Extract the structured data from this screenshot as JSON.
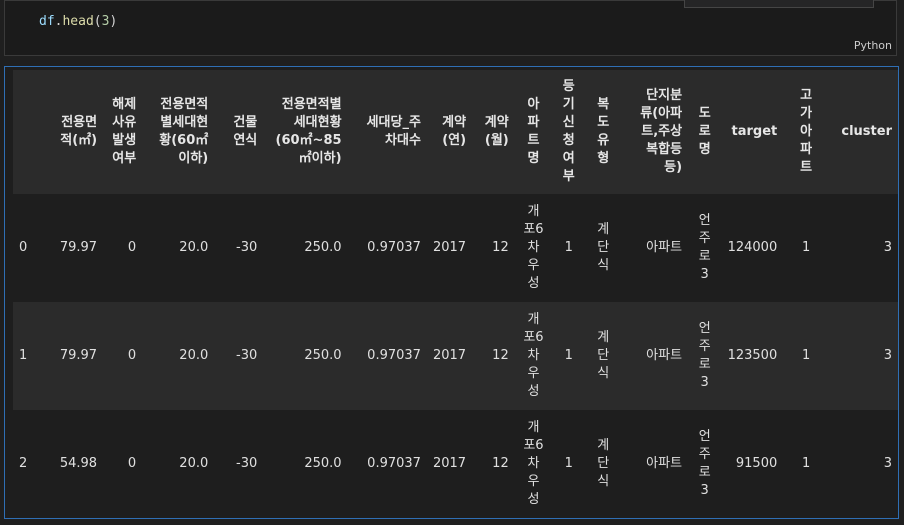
{
  "code_cell": {
    "code_object": "df",
    "code_method": "head",
    "code_arg": "3",
    "language": "Python"
  },
  "table": {
    "columns": [
      {
        "label": "",
        "type": "idx"
      },
      {
        "label": "전용면\n적(㎡)",
        "type": "num"
      },
      {
        "label": "해제\n사유\n발생\n여부",
        "type": "num"
      },
      {
        "label": "전용면적\n별세대현\n황(60㎡\n이하)",
        "type": "num"
      },
      {
        "label": "건물\n연식",
        "type": "num"
      },
      {
        "label": "전용면적별\n세대현황\n(60㎡~85\n㎡이하)",
        "type": "num"
      },
      {
        "label": "세대당_주\n차대수",
        "type": "num"
      },
      {
        "label": "계약\n(연)",
        "type": "num"
      },
      {
        "label": "계약\n(월)",
        "type": "num"
      },
      {
        "label": "아\n파\n트\n명",
        "type": "vert"
      },
      {
        "label": "등\n기\n신\n청\n여\n부",
        "type": "vert"
      },
      {
        "label": "복\n도\n유\n형",
        "type": "vert"
      },
      {
        "label": "단지분\n류(아파\n트,주상\n복합등\n등)",
        "type": "num"
      },
      {
        "label": "도\n로\n명",
        "type": "vert"
      },
      {
        "label": "target",
        "type": "num"
      },
      {
        "label": "고\n가\n아\n파\n트",
        "type": "vert"
      },
      {
        "label": "cluster",
        "type": "num"
      }
    ],
    "rows": [
      [
        "0",
        "79.97",
        "0",
        "20.0",
        "-30",
        "250.0",
        "0.97037",
        "2017",
        "12",
        "개\n포6\n차\n우\n성",
        "1",
        "계\n단\n식",
        "아파트",
        "언\n주\n로\n3",
        "124000",
        "1",
        "3"
      ],
      [
        "1",
        "79.97",
        "0",
        "20.0",
        "-30",
        "250.0",
        "0.97037",
        "2017",
        "12",
        "개\n포6\n차\n우\n성",
        "1",
        "계\n단\n식",
        "아파트",
        "언\n주\n로\n3",
        "123500",
        "1",
        "3"
      ],
      [
        "2",
        "54.98",
        "0",
        "20.0",
        "-30",
        "250.0",
        "0.97037",
        "2017",
        "12",
        "개\n포6\n차\n우\n성",
        "1",
        "계\n단\n식",
        "아파트",
        "언\n주\n로\n3",
        "91500",
        "1",
        "3"
      ]
    ]
  }
}
